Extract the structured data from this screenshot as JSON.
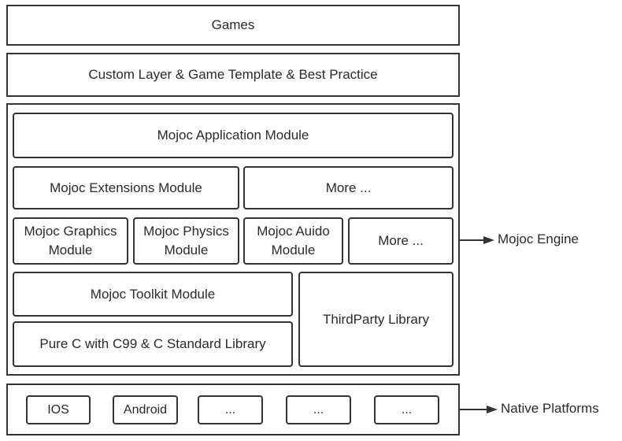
{
  "layers": {
    "games": "Games",
    "custom_layer": "Custom Layer & Game Template & Best Practice",
    "engine": {
      "application": "Mojoc Application Module",
      "extensions": "Mojoc Extensions Module",
      "extensions_more": "More ...",
      "graphics": "Mojoc Graphics\nModule",
      "physics": "Mojoc Physics\nModule",
      "audio": "Mojoc Auido\nModule",
      "modules_more": "More ...",
      "toolkit": "Mojoc Toolkit Module",
      "pure_c": "Pure C with C99 & C Standard Library",
      "third_party": "ThirdParty Library"
    },
    "platforms": [
      "IOS",
      "Android",
      "...",
      "...",
      "..."
    ]
  },
  "labels": {
    "engine": "Mojoc Engine",
    "native": "Native Platforms"
  }
}
